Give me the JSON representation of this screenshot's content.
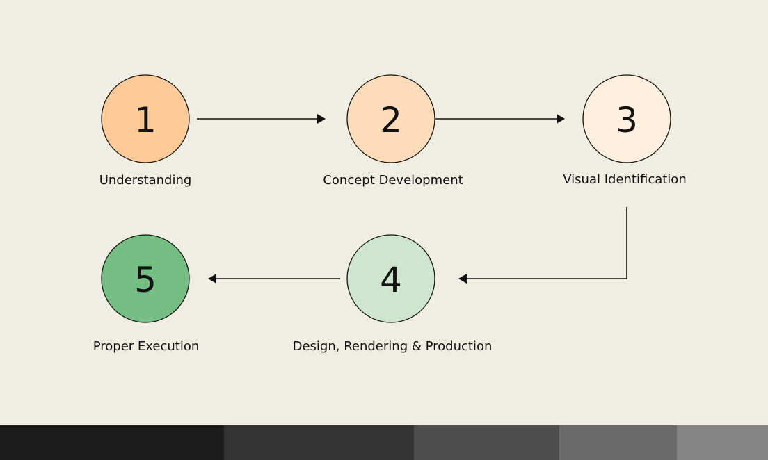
{
  "steps": [
    {
      "number": "1",
      "label": "Understanding",
      "color": "#fecb98"
    },
    {
      "number": "2",
      "label": "Concept Development",
      "color": "#fddcb9"
    },
    {
      "number": "3",
      "label": "Visual Identification",
      "color": "#fdeedd"
    },
    {
      "number": "4",
      "label": "Design, Rendering & Production",
      "color": "#cde6cd"
    },
    {
      "number": "5",
      "label": "Proper Execution",
      "color": "#75bf84"
    }
  ],
  "colors": {
    "background": "#f0eee3",
    "stroke": "#111111",
    "footer_swatches": [
      "#1b1b1b",
      "#333333",
      "#4e4e4e",
      "#6a6a6a",
      "#858585"
    ]
  }
}
